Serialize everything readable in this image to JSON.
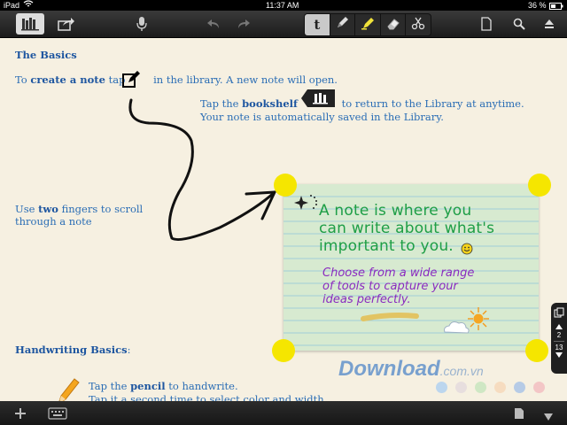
{
  "status": {
    "device": "iPad",
    "time": "11:37 AM",
    "battery": "36 %"
  },
  "toolbar": {
    "left": [
      "bookshelf-icon",
      "share-icon"
    ],
    "center": [
      "microphone-icon",
      "undo-icon",
      "redo-icon"
    ],
    "tools": [
      "text-tool-icon",
      "pen-icon",
      "highlighter-icon",
      "eraser-icon",
      "scissors-icon"
    ],
    "text_tool_label": "t",
    "right": [
      "page-icon",
      "search-icon",
      "eject-icon"
    ]
  },
  "content": {
    "basics_title": "The Basics",
    "create_pre": "To ",
    "create_bold": "create a note",
    "create_mid": " tap",
    "create_post": " in the library. A new note will open.",
    "bookshelf_pre": "Tap the ",
    "bookshelf_bold": "bookshelf",
    "bookshelf_post": " to return to the Library at anytime.",
    "bookshelf_line2": "Your note is automatically saved in the Library.",
    "scroll_pre": "Use ",
    "scroll_bold": "two",
    "scroll_post": " fingers to scroll",
    "scroll_line2": "through a note",
    "handwriting_title": "Handwriting Basics",
    "handwriting_colon": ":",
    "pencil_pre": "Tap the ",
    "pencil_bold": "pencil",
    "pencil_post": " to handwrite.",
    "pencil_line2": "Tap it a second time to select color and width."
  },
  "note": {
    "green_lines": [
      "A note is where you",
      "can write about what's",
      "important to you."
    ],
    "purple_lines": [
      "Choose from a wide range",
      "of tools to capture your",
      "ideas perfectly."
    ]
  },
  "pager": {
    "current": "2",
    "total": "13"
  },
  "watermark": {
    "brand": "Download",
    "domain": ".com.vn"
  },
  "colors": {
    "link_blue": "#2a6db5",
    "handle_yellow": "#f5e600",
    "green_ink": "#1e9e46",
    "purple_ink": "#8a2bbf",
    "palette": [
      "#bcd6ee",
      "#e7dede",
      "#cfe7c4",
      "#f6dcc0",
      "#b6cbe6",
      "#f3c6c6"
    ]
  },
  "bottombar": {
    "left": [
      "add-icon",
      "keyboard-icon"
    ],
    "right": [
      "page-icon",
      "down-icon"
    ]
  }
}
